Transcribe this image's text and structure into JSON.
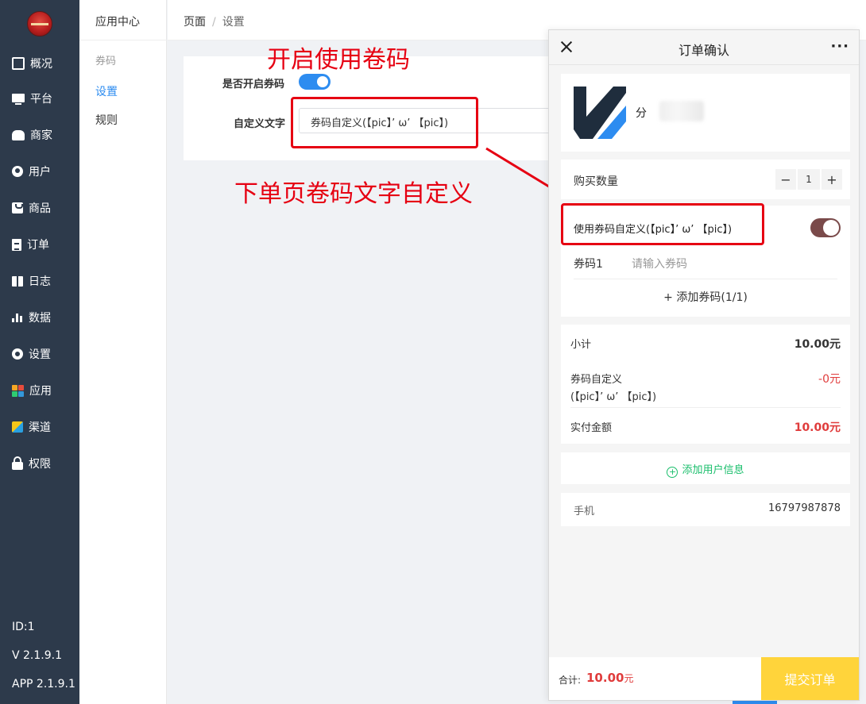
{
  "sidebar": {
    "items": [
      {
        "label": "概况",
        "icon": "chart-wave-icon"
      },
      {
        "label": "平台",
        "icon": "monitor-icon"
      },
      {
        "label": "商家",
        "icon": "shop-icon"
      },
      {
        "label": "用户",
        "icon": "user-icon"
      },
      {
        "label": "商品",
        "icon": "product-box-icon"
      },
      {
        "label": "订单",
        "icon": "order-doc-icon"
      },
      {
        "label": "日志",
        "icon": "log-book-icon"
      },
      {
        "label": "数据",
        "icon": "bar-chart-icon"
      },
      {
        "label": "设置",
        "icon": "gear-icon"
      },
      {
        "label": "应用",
        "icon": "app-grid-icon"
      },
      {
        "label": "渠道",
        "icon": "channel-cube-icon"
      },
      {
        "label": "权限",
        "icon": "lock-icon"
      }
    ],
    "id_text": "ID:1",
    "version": "V 2.1.9.1",
    "app_version": "APP 2.1.9.1"
  },
  "submenu": {
    "title": "应用中心",
    "group": "券码",
    "links": [
      "设置",
      "规则"
    ]
  },
  "breadcrumb": {
    "root": "页面",
    "separator": "/",
    "current": "设置"
  },
  "settings": {
    "enable_label": "是否开启券码",
    "enable_value": true,
    "custom_text_label": "自定义文字",
    "custom_text_value": "券码自定义(【pic】’ ω’ 【pic】)"
  },
  "annotations": {
    "enable_note": "开启使用卷码",
    "custom_note": "下单页卷码文字自定义"
  },
  "phone": {
    "title": "订单确认",
    "more": "···",
    "product_name": "分",
    "quantity_label": "购买数量",
    "quantity_value": "1",
    "minus": "−",
    "plus": "+",
    "coupon_toggle_label": "使用券码自定义(【pic】’ ω’ 【pic】)",
    "coupon_toggle_value": true,
    "coupon_code_label": "券码1",
    "coupon_code_placeholder": "请输入券码",
    "add_coupon": "+ 添加券码(1/1)",
    "subtotal_label": "小计",
    "subtotal_value": "10.00元",
    "discount_label_line1": "券码自定义",
    "discount_label_line2": "(【pic】’ ω’ 【pic】)",
    "discount_value": "-0元",
    "paid_label": "实付金额",
    "paid_value": "10.00元",
    "add_user_info": "添加用户信息",
    "add_user_plus": "+",
    "phone_label": "手机",
    "phone_value": "16797987878",
    "total_label": "合计:",
    "total_value": "10.00",
    "total_unit": "元",
    "submit": "提交订单"
  },
  "colors": {
    "sidebar_bg": "#2d3a4b",
    "primary": "#2d8cf0",
    "annotation_red": "#e60012",
    "price_red": "#e03c3c",
    "submit_yellow": "#ffd43b",
    "success_green": "#19be6b"
  }
}
